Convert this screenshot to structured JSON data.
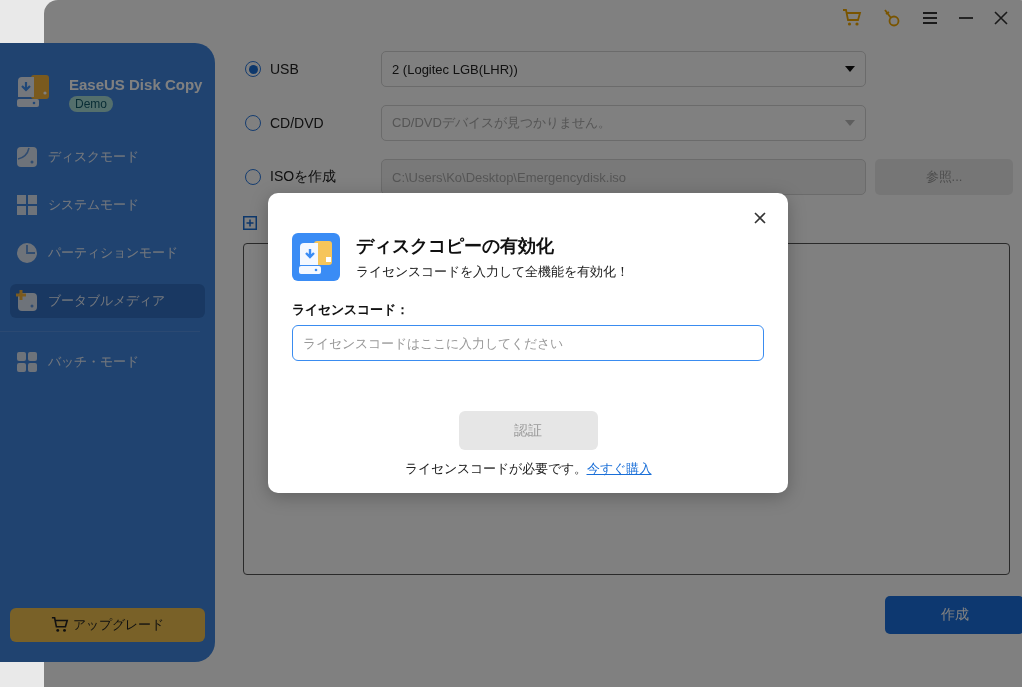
{
  "sidebar": {
    "app_name": "EaseUS Disk Copy",
    "badge": "Demo",
    "items": [
      {
        "label": "ディスクモード",
        "kind": "disk",
        "selected": false
      },
      {
        "label": "システムモード",
        "kind": "windows",
        "selected": false
      },
      {
        "label": "パーティションモード",
        "kind": "pie",
        "selected": false
      },
      {
        "label": "ブータブルメディア",
        "kind": "bootable",
        "selected": true
      },
      {
        "label": "バッチ・モード",
        "kind": "grid",
        "selected": false
      }
    ],
    "upgrade_button": "アップグレード"
  },
  "sources": [
    {
      "label": "USB",
      "selected": true,
      "kind": "dropdown",
      "value": "2 (Logitec LGB(LHR))",
      "disabled": false
    },
    {
      "label": "CD/DVD",
      "selected": false,
      "kind": "dropdown",
      "value": "CD/DVDデバイスが見つかりません。",
      "disabled": true
    },
    {
      "label": "ISOを作成",
      "selected": false,
      "kind": "path",
      "value": "C:\\Users\\Ko\\Desktop\\Emergencydisk.iso",
      "disabled": true,
      "button": "参照..."
    }
  ],
  "create_button": "作成",
  "dialog": {
    "title": "ディスクコピーの有効化",
    "subtitle": "ライセンスコードを入力して全機能を有効化！",
    "field_label": "ライセンスコード：",
    "placeholder": "ライセンスコードはここに入力してください",
    "verify_button": {
      "label": "認証",
      "disabled": true
    },
    "footer_text": "ライセンスコードが必要です。",
    "buy_link": "今すぐ購入"
  }
}
